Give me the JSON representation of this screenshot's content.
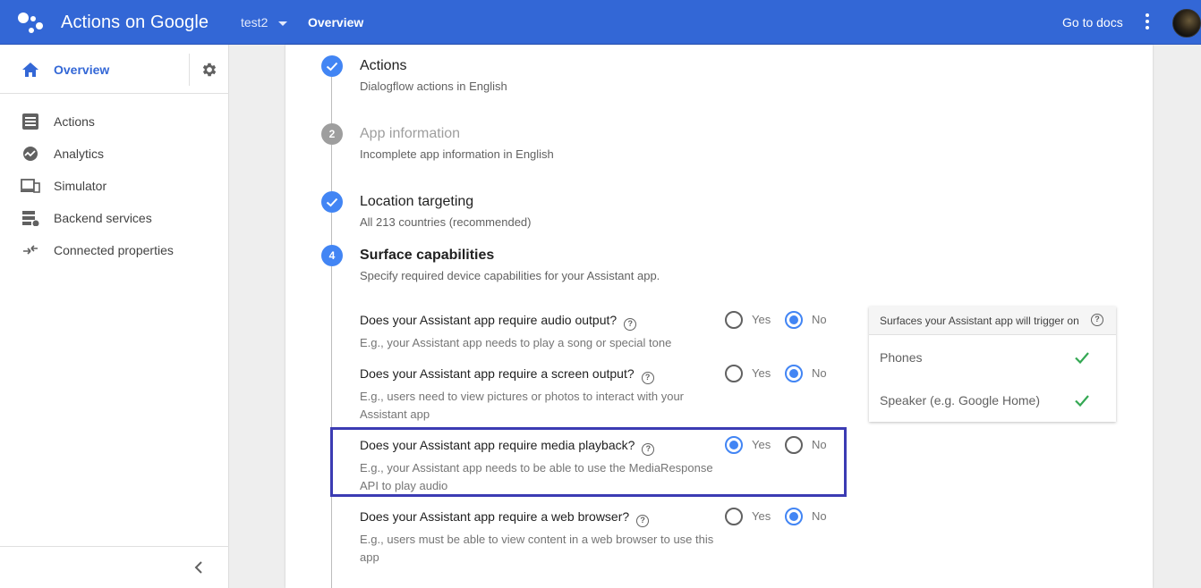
{
  "header": {
    "app_title": "Actions on Google",
    "project": "test2",
    "breadcrumb": "Overview",
    "docs_link": "Go to docs",
    "brand_color": "#3367d6"
  },
  "sidebar": {
    "overview_label": "Overview",
    "items": [
      {
        "label": "Actions",
        "icon": "list-icon"
      },
      {
        "label": "Analytics",
        "icon": "analytics-icon"
      },
      {
        "label": "Simulator",
        "icon": "devices-icon"
      },
      {
        "label": "Backend services",
        "icon": "storage-icon"
      },
      {
        "label": "Connected properties",
        "icon": "compare-arrows-icon"
      }
    ]
  },
  "steps": [
    {
      "marker": "",
      "title": "Actions",
      "subtitle": "Dialogflow actions in English",
      "state": "complete"
    },
    {
      "marker": "2",
      "title": "App information",
      "subtitle": "Incomplete app information in English",
      "state": "pending"
    },
    {
      "marker": "",
      "title": "Location targeting",
      "subtitle": "All 213 countries (recommended)",
      "state": "complete"
    },
    {
      "marker": "4",
      "title": "Surface capabilities",
      "subtitle": "Specify required device capabilities for your Assistant app.",
      "state": "active"
    }
  ],
  "questions": [
    {
      "question": "Does your Assistant app require audio output?",
      "description": "E.g., your Assistant app needs to play a song or special tone",
      "yes_label": "Yes",
      "no_label": "No",
      "selected": "No"
    },
    {
      "question": "Does your Assistant app require a screen output?",
      "description": "E.g., users need to view pictures or photos to interact with your Assistant app",
      "yes_label": "Yes",
      "no_label": "No",
      "selected": "No"
    },
    {
      "question": "Does your Assistant app require media playback?",
      "description": "E.g., your Assistant app needs to be able to use the MediaResponse API to play audio",
      "yes_label": "Yes",
      "no_label": "No",
      "selected": "Yes"
    },
    {
      "question": "Does your Assistant app require a web browser?",
      "description": "E.g., users must be able to view content in a web browser to use this app",
      "yes_label": "Yes",
      "no_label": "No",
      "selected": "No"
    }
  ],
  "surfaces_panel": {
    "title": "Surfaces your Assistant app will trigger on",
    "items": [
      {
        "label": "Phones",
        "enabled": true
      },
      {
        "label": "Speaker (e.g. Google Home)",
        "enabled": true
      }
    ]
  },
  "colors": {
    "accent": "#4285f4",
    "check": "#34a853",
    "highlight_border": "#3b3bb3"
  }
}
